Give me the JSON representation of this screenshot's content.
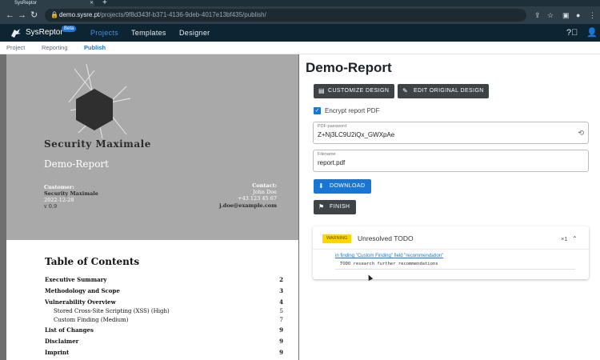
{
  "browser": {
    "tab_title": "SysReptor",
    "url_host": "demo.sysre.pt",
    "url_path": "/projects/9f8d343f-b371-4136-9deb-4017e13bf435/publish/"
  },
  "app": {
    "brand": "SysReptor",
    "beta": "Beta",
    "nav": [
      "Projects",
      "Templates",
      "Designer"
    ],
    "active_nav": "Projects"
  },
  "subnav": {
    "items": [
      "Project",
      "Reporting",
      "Publish"
    ],
    "active": "Publish"
  },
  "preview": {
    "cover": {
      "title": "Security Maximale",
      "subtitle": "Demo-Report",
      "customer_label": "Customer:",
      "customer_name": "Security Maximale",
      "date": "2022-12-28",
      "version": "v 0.9",
      "contact_label": "Contact:",
      "contact_name": "John Doe",
      "contact_phone": "+43 123 45 67",
      "contact_email": "j.doe@example.com"
    },
    "toc": {
      "title": "Table of Contents",
      "entries": [
        {
          "label": "Executive Summary",
          "page": "2"
        },
        {
          "label": "Methodology and Scope",
          "page": "3"
        },
        {
          "label": "Vulnerability Overview",
          "page": "4"
        },
        {
          "label": "Stored Cross-Site Scripting (XSS) (High)",
          "page": "5"
        },
        {
          "label": "Custom Finding (Medium)",
          "page": "7"
        },
        {
          "label": "List of Changes",
          "page": "9"
        },
        {
          "label": "Disclaimer",
          "page": "9"
        },
        {
          "label": "Imprint",
          "page": "9"
        }
      ]
    }
  },
  "publish": {
    "title": "Demo-Report",
    "customize_button": "CUSTOMIZE DESIGN",
    "edit_design_button": "EDIT ORIGINAL DESIGN",
    "encrypt_label": "Encrypt report PDF",
    "encrypt_checked": true,
    "password_label": "PDF password",
    "password_value": "Z+Nj3LC9U2iQx_GWXpAe",
    "filename_label": "Filename",
    "filename_value": "report.pdf",
    "download_button": "DOWNLOAD",
    "finish_button": "FINISH",
    "todo": {
      "badge": "WARNING",
      "title": "Unresolved TODO",
      "count": "×1",
      "link": "in finding \"Custom Finding\" field \"recommendation\"",
      "message": "TODO research further recommendations"
    }
  },
  "colors": {
    "header_bg": "#0d2432",
    "accent": "#1976d2",
    "warning": "#ffd600",
    "dark_button": "#3e4347"
  }
}
